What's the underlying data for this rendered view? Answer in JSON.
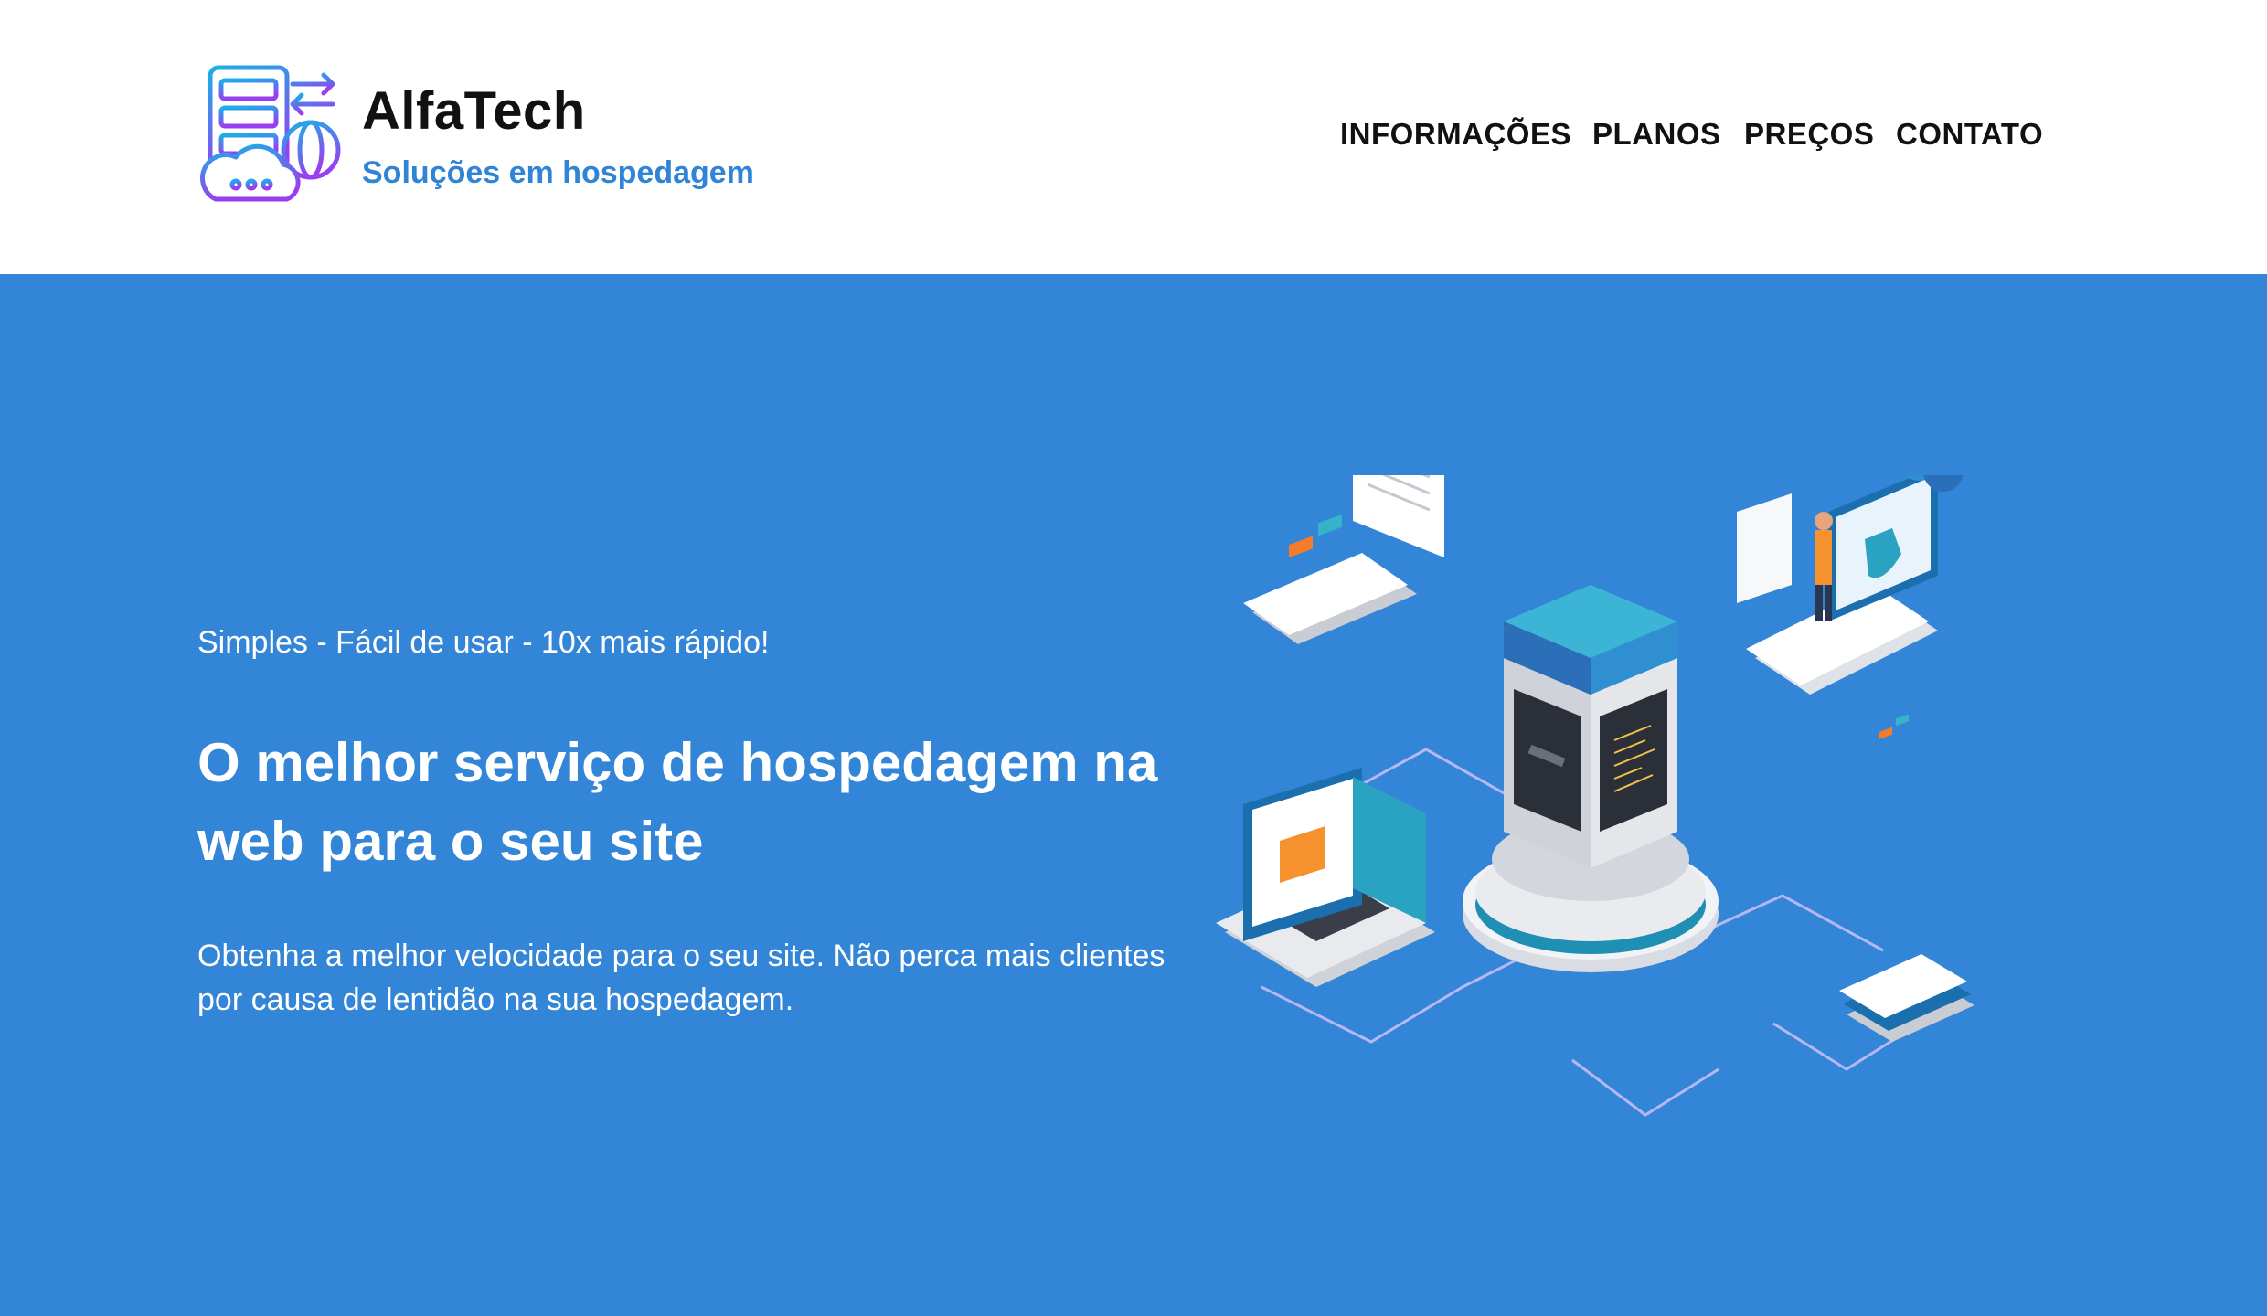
{
  "brand": {
    "name": "AlfaTech",
    "tagline": "Soluções em hospedagem",
    "logo_icon": "server-cloud-globe-icon"
  },
  "nav": {
    "items": [
      {
        "label": "INFORMAÇÕES"
      },
      {
        "label": "PLANOS"
      },
      {
        "label": "PREÇOS"
      },
      {
        "label": "CONTATO"
      }
    ]
  },
  "hero": {
    "kicker": "Simples - Fácil de usar - 10x mais rápido!",
    "title": "O melhor serviço de hospedagem na web para o seu site",
    "description": "Obtenha a melhor velocidade para o seu site. Não perca mais clientes por causa de lentidão na sua hospedagem.",
    "illustration": "isometric-hosting-server-illustration"
  },
  "colors": {
    "accent_blue": "#3385d7",
    "tagline_blue": "#2f84d6",
    "logo_gradient_start": "#1ab0e8",
    "logo_gradient_end": "#9b3df0"
  }
}
